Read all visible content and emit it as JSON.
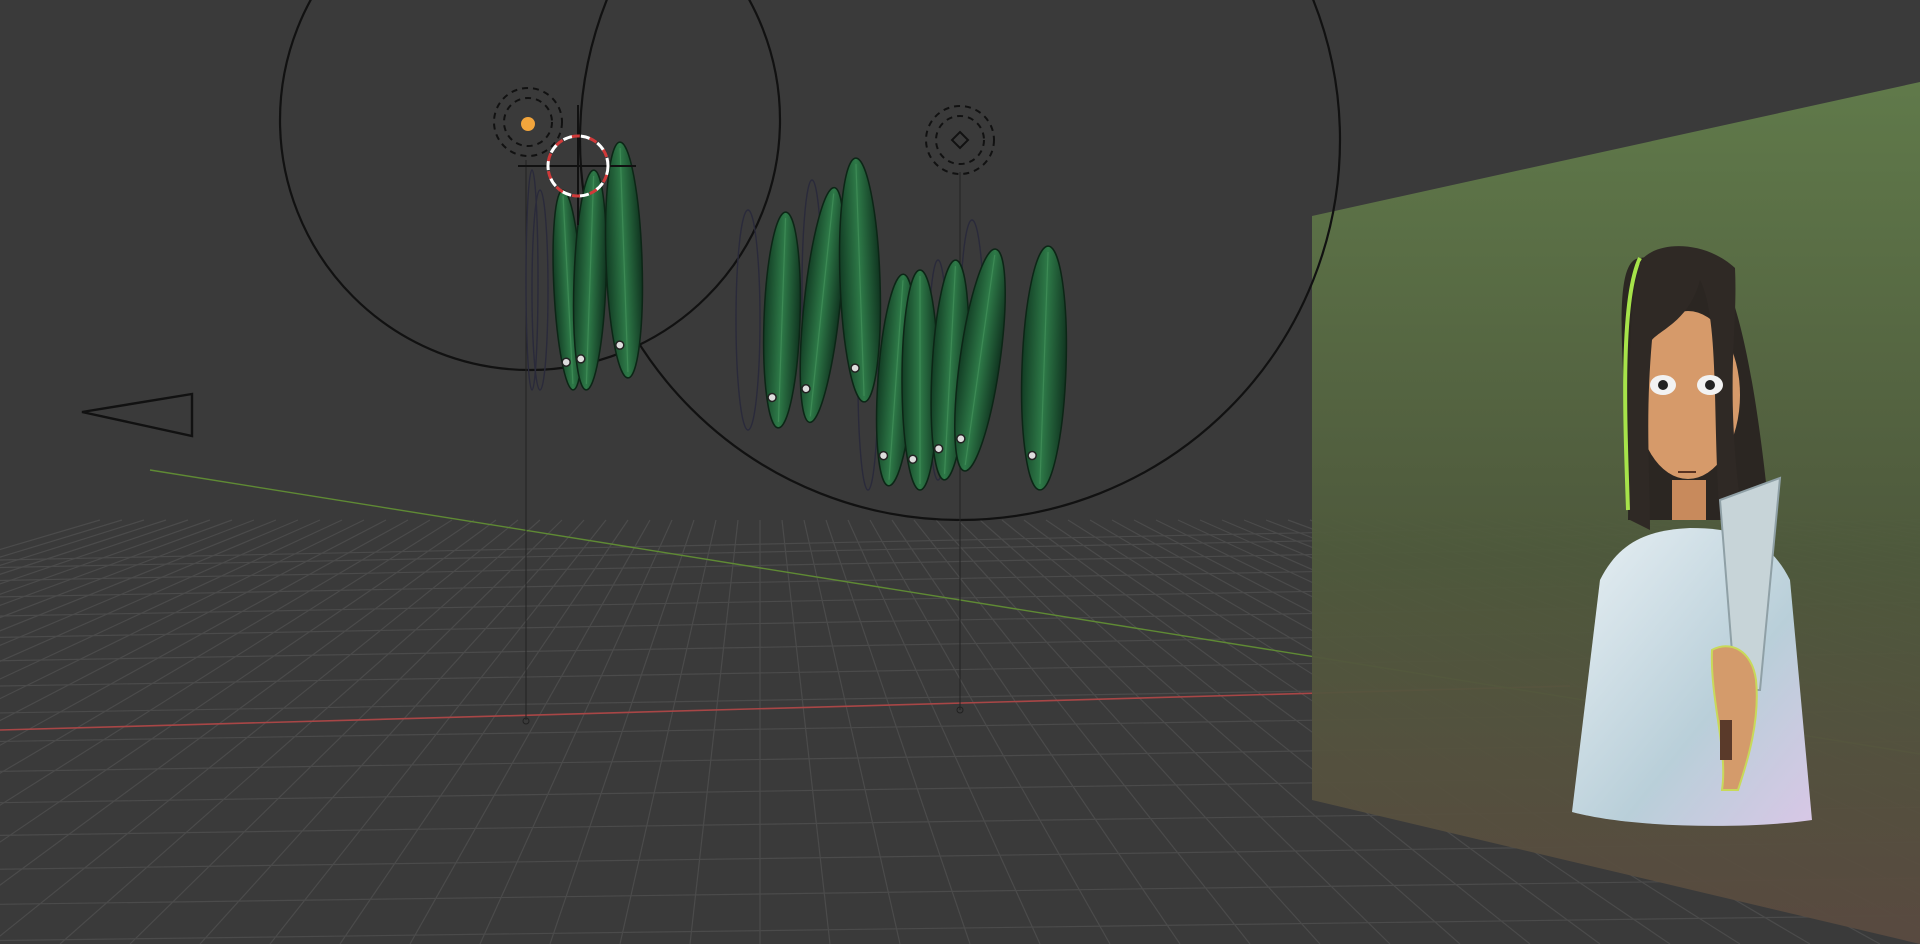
{
  "viewport": {
    "mode": "3d-viewport",
    "background": "#3a3a3a",
    "floor_grid_color": "#4a4a4a",
    "x_axis_color": "#b24545",
    "y_axis_color": "#6f9a3c",
    "wireframe_color": "#111111"
  },
  "scene": {
    "objects": [
      {
        "name": "empty-sphere-left",
        "type": "empty",
        "icon": "empty-icon"
      },
      {
        "name": "empty-sphere-right",
        "type": "empty",
        "icon": "empty-icon"
      },
      {
        "name": "leaf-cluster-left",
        "type": "mesh",
        "icon": "leaf-mesh-icon"
      },
      {
        "name": "leaf-cluster-right",
        "type": "mesh",
        "icon": "leaf-mesh-icon"
      },
      {
        "name": "reference-image-plane",
        "type": "image",
        "icon": "image-plane-icon"
      },
      {
        "name": "camera",
        "type": "camera",
        "icon": "camera-icon"
      },
      {
        "name": "light-left",
        "type": "light",
        "icon": "light-icon"
      },
      {
        "name": "light-right",
        "type": "light",
        "icon": "light-icon"
      },
      {
        "name": "3d-cursor",
        "type": "cursor",
        "icon": "crosshair-icon"
      }
    ],
    "colors": {
      "leaf": "#1f5a36",
      "leaf_highlight": "#3d8a55",
      "image_plane": "#5f7a47",
      "selection": "#f2a53c"
    }
  }
}
